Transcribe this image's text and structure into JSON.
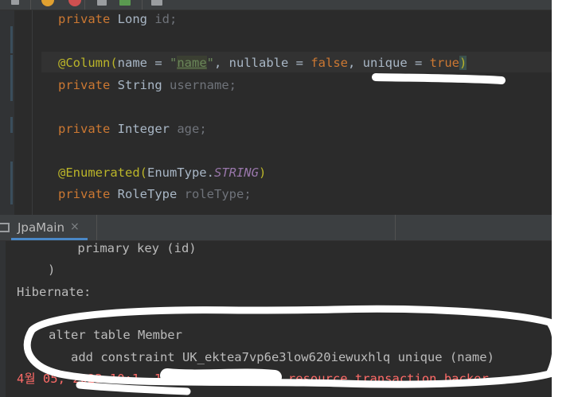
{
  "editor": {
    "lines": [
      {
        "kw": "private",
        "type": "Long",
        "field": "id;"
      },
      {
        "annotation": "@Column(",
        "name_key": "name",
        "eq1": " = ",
        "name_value": "\"name\"",
        "nullable_part": ", nullable = ",
        "nullable_value": "false",
        "unique_part": ", unique = ",
        "unique_value": "true",
        "close_paren": ")"
      },
      {
        "kw": "private",
        "type": "String",
        "field": "username;"
      },
      {
        "kw": "private",
        "type": "Integer",
        "field": "age;"
      },
      {
        "annotation": "@Enumerated(",
        "enum_class": "EnumType.",
        "enum_value": "STRING",
        "close_paren": ")"
      },
      {
        "kw": "private",
        "type": "RoleType",
        "field": "roleType;"
      }
    ]
  },
  "run_panel": {
    "tab_label": "JpaMain",
    "tab_close": "×"
  },
  "console": {
    "lines": [
      "    primary key (id)",
      ")",
      "Hibernate:",
      "",
      "alter table Member",
      "   add constraint UK_ektea7vp6e3low620iewuxhlq unique (name)",
      "4월 05, 2023 10:1  1 PM org. ... ate resource transaction backer"
    ]
  },
  "colors": {
    "editor_bg": "#2b2b2b",
    "keyword": "#cc7832",
    "annotation": "#bbb529",
    "string": "#6a8759",
    "constant": "#9876aa",
    "error_text": "#ff6b68",
    "tab_underline": "#4a88c7"
  }
}
